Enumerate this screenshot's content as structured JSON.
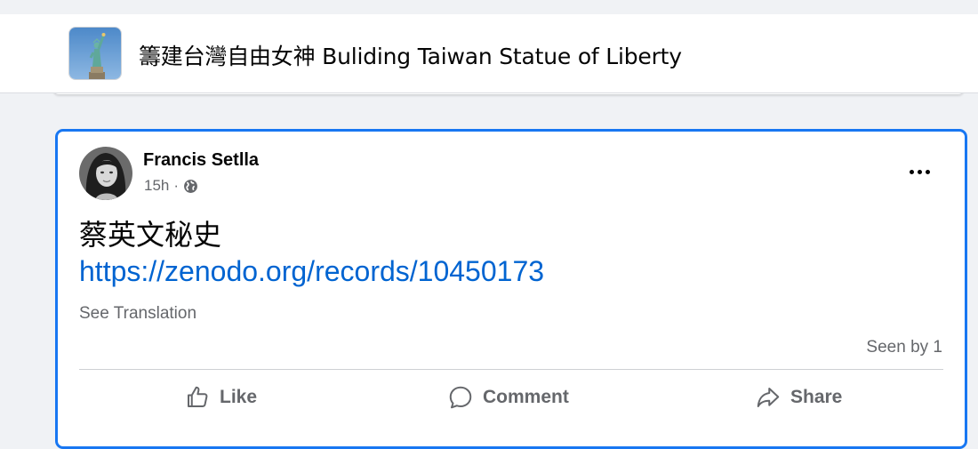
{
  "group": {
    "name": "籌建台灣自由女神 Buliding Taiwan Statue of Liberty",
    "avatar_icon": "statue-of-liberty-image"
  },
  "post": {
    "author": "Francis Setlla",
    "time": "15h",
    "separator": "·",
    "audience_icon": "globe-icon",
    "text": "蔡英文秘史",
    "link": "https://zenodo.org/records/10450173",
    "see_translation": "See Translation",
    "seen_by": "Seen by 1"
  },
  "actions": {
    "like": "Like",
    "comment": "Comment",
    "share": "Share"
  },
  "colors": {
    "accent": "#1877f2",
    "link": "#0064d1",
    "muted_text": "#65676b",
    "background": "#f0f2f5"
  }
}
